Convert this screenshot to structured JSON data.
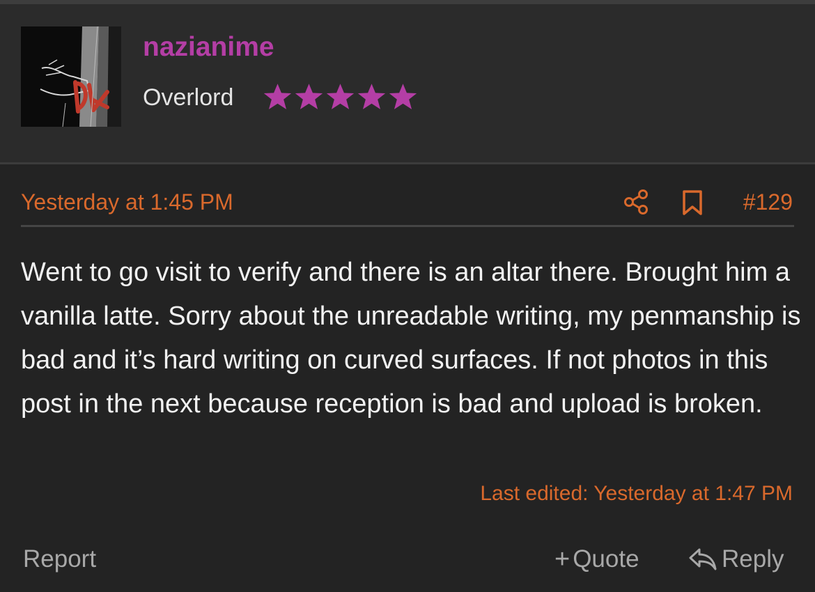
{
  "user": {
    "username": "nazianime",
    "title": "Overlord",
    "rating_stars": 5,
    "avatar_icon": "avatar-image",
    "username_color": "#b43ea5",
    "star_color": "#b43ea5"
  },
  "post": {
    "date": "Yesterday at 1:45 PM",
    "number": "#129",
    "share_icon": "share-icon",
    "bookmark_icon": "bookmark-icon",
    "body": "Went to go visit to verify and there is an altar there. Brought him a vanilla latte. Sorry about the unreadable writing, my penmanship is bad and it’s hard writing on curved surfaces. If not photos in this post in the next because reception is bad and upload is broken.",
    "last_edited": "Last edited: Yesterday at 1:47 PM",
    "accent_color": "#d9692c"
  },
  "actions": {
    "report_label": "Report",
    "quote_label": "Quote",
    "reply_label": "Reply"
  }
}
